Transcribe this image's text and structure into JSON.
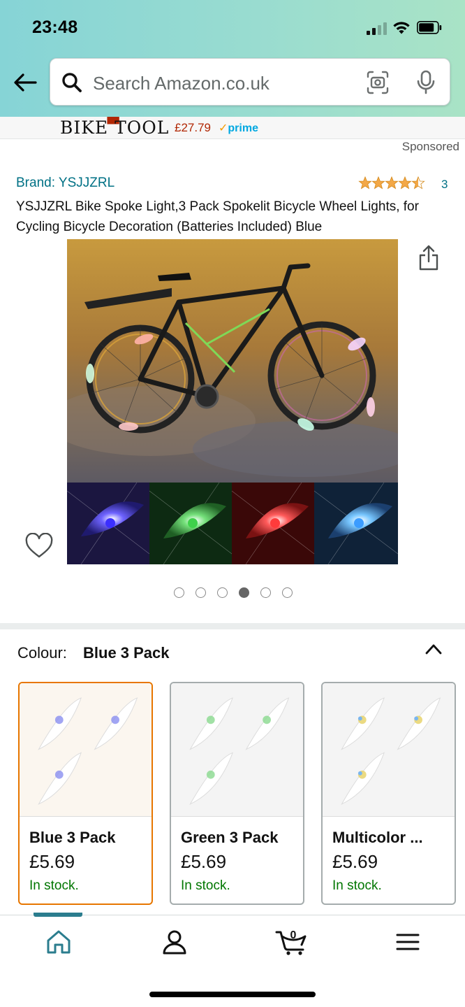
{
  "status_bar": {
    "time": "23:48"
  },
  "search": {
    "placeholder": "Search Amazon.co.uk"
  },
  "ad_banner": {
    "brand": "BIKE TOOL",
    "price": "£27.79",
    "prime_label": "prime"
  },
  "sponsored_label": "Sponsored",
  "product": {
    "brand": "Brand: YSJJZRL",
    "rating": 4.5,
    "rating_count": "3",
    "title": "YSJJZRL Bike Spoke Light,3 Pack Spokelit Bicycle Wheel Lights, for Cycling Bicycle Decoration (Batteries Included) Blue"
  },
  "image_carousel": {
    "count": 6,
    "active_index": 3
  },
  "colour_selector": {
    "label": "Colour:",
    "selected": "Blue 3 Pack",
    "options": [
      {
        "name": "Blue 3 Pack",
        "price": "£5.69",
        "stock": "In stock.",
        "accent": "#8a8ff0"
      },
      {
        "name": "Green 3 Pack",
        "price": "£5.69",
        "stock": "In stock.",
        "accent": "#8ad98f"
      },
      {
        "name": "Multicolor ...",
        "price": "£5.69",
        "stock": "In stock.",
        "accent": "#e8d46c"
      }
    ]
  },
  "bottom_nav": {
    "items": [
      "home-icon",
      "account-icon",
      "cart-icon",
      "menu-icon"
    ],
    "cart_count": "0",
    "active": "home"
  },
  "colors": {
    "link": "#007185",
    "price_red": "#b12704",
    "in_stock_green": "#007600",
    "selected_border": "#e77600",
    "star": "#f3a847"
  }
}
